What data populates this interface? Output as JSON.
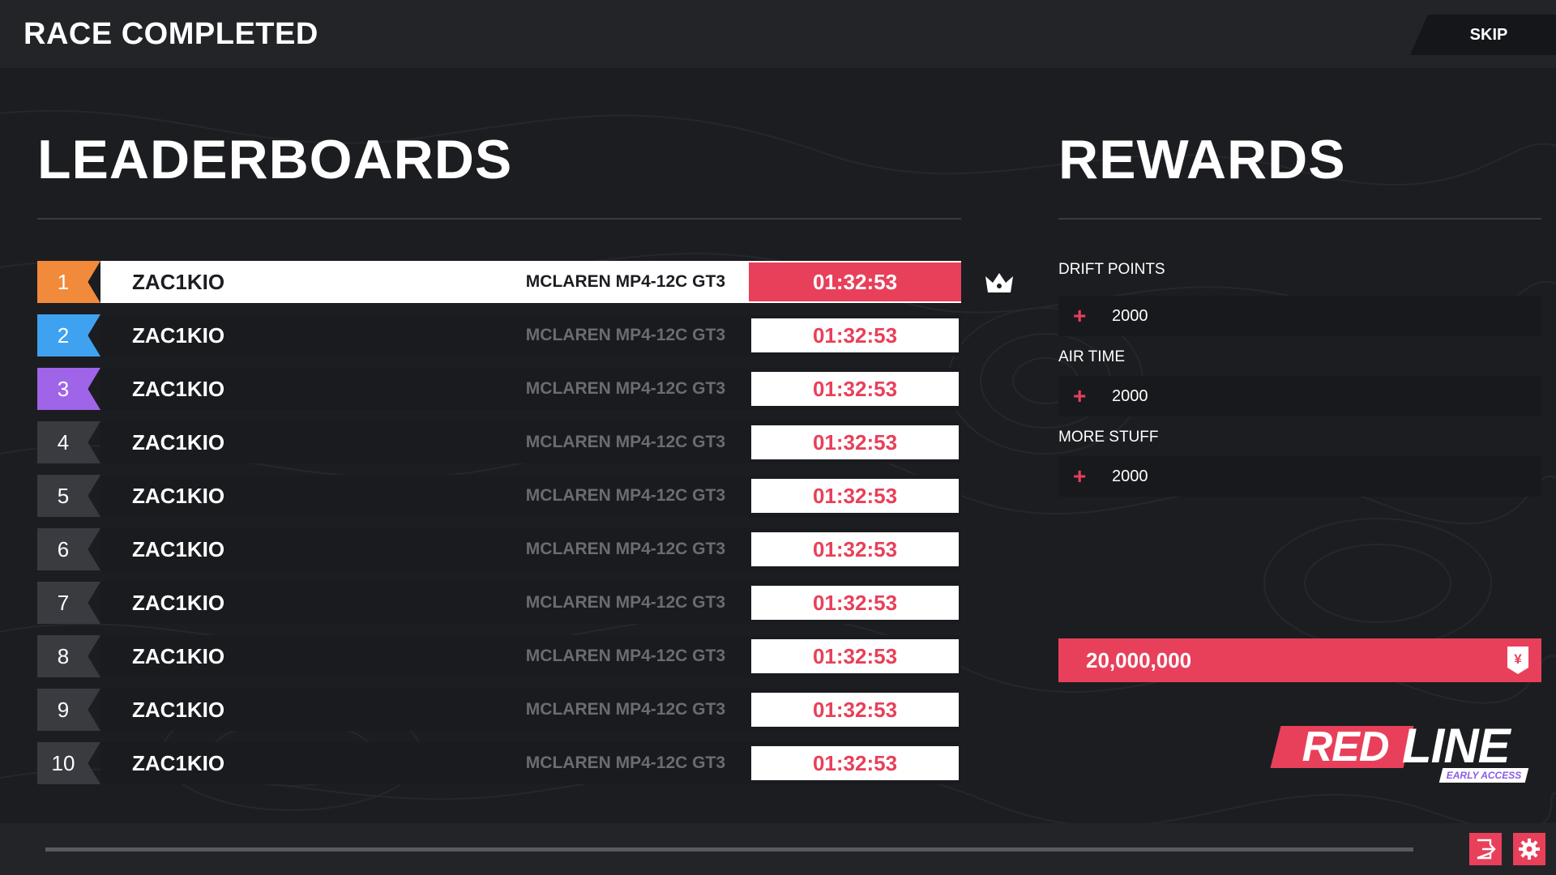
{
  "header": {
    "title": "RACE COMPLETED",
    "skip_label": "SKIP"
  },
  "leaderboard": {
    "title": "LEADERBOARDS",
    "rows": [
      {
        "position": "1",
        "name": "ZAC1KIO",
        "car": "MCLAREN MP4-12C GT3",
        "time": "01:32:53",
        "badge_color": "#f28a3b"
      },
      {
        "position": "2",
        "name": "ZAC1KIO",
        "car": "MCLAREN MP4-12C GT3",
        "time": "01:32:53",
        "badge_color": "#3fa2f0"
      },
      {
        "position": "3",
        "name": "ZAC1KIO",
        "car": "MCLAREN MP4-12C GT3",
        "time": "01:32:53",
        "badge_color": "#a064e8"
      },
      {
        "position": "4",
        "name": "ZAC1KIO",
        "car": "MCLAREN MP4-12C GT3",
        "time": "01:32:53",
        "badge_color": "#3a3b40"
      },
      {
        "position": "5",
        "name": "ZAC1KIO",
        "car": "MCLAREN MP4-12C GT3",
        "time": "01:32:53",
        "badge_color": "#3a3b40"
      },
      {
        "position": "6",
        "name": "ZAC1KIO",
        "car": "MCLAREN MP4-12C GT3",
        "time": "01:32:53",
        "badge_color": "#3a3b40"
      },
      {
        "position": "7",
        "name": "ZAC1KIO",
        "car": "MCLAREN MP4-12C GT3",
        "time": "01:32:53",
        "badge_color": "#3a3b40"
      },
      {
        "position": "8",
        "name": "ZAC1KIO",
        "car": "MCLAREN MP4-12C GT3",
        "time": "01:32:53",
        "badge_color": "#3a3b40"
      },
      {
        "position": "9",
        "name": "ZAC1KIO",
        "car": "MCLAREN MP4-12C GT3",
        "time": "01:32:53",
        "badge_color": "#3a3b40"
      },
      {
        "position": "10",
        "name": "ZAC1KIO",
        "car": "MCLAREN MP4-12C GT3",
        "time": "01:32:53",
        "badge_color": "#3a3b40"
      }
    ]
  },
  "rewards": {
    "title": "REWARDS",
    "items": [
      {
        "label": "DRIFT POINTS",
        "sign": "+",
        "value": "2000"
      },
      {
        "label": "AIR TIME",
        "sign": "+",
        "value": "2000"
      },
      {
        "label": "MORE STUFF",
        "sign": "+",
        "value": "2000"
      }
    ],
    "total": "20,000,000",
    "currency_icon": "yen-icon"
  },
  "logo": {
    "part1": "RED",
    "part2": "LINE",
    "tag": "EARLY ACCESS"
  },
  "footer": {
    "progress": 1.0,
    "exit_icon": "exit-icon",
    "settings_icon": "gear-icon"
  },
  "colors": {
    "accent": "#e8405a",
    "background": "#1c1d21"
  }
}
